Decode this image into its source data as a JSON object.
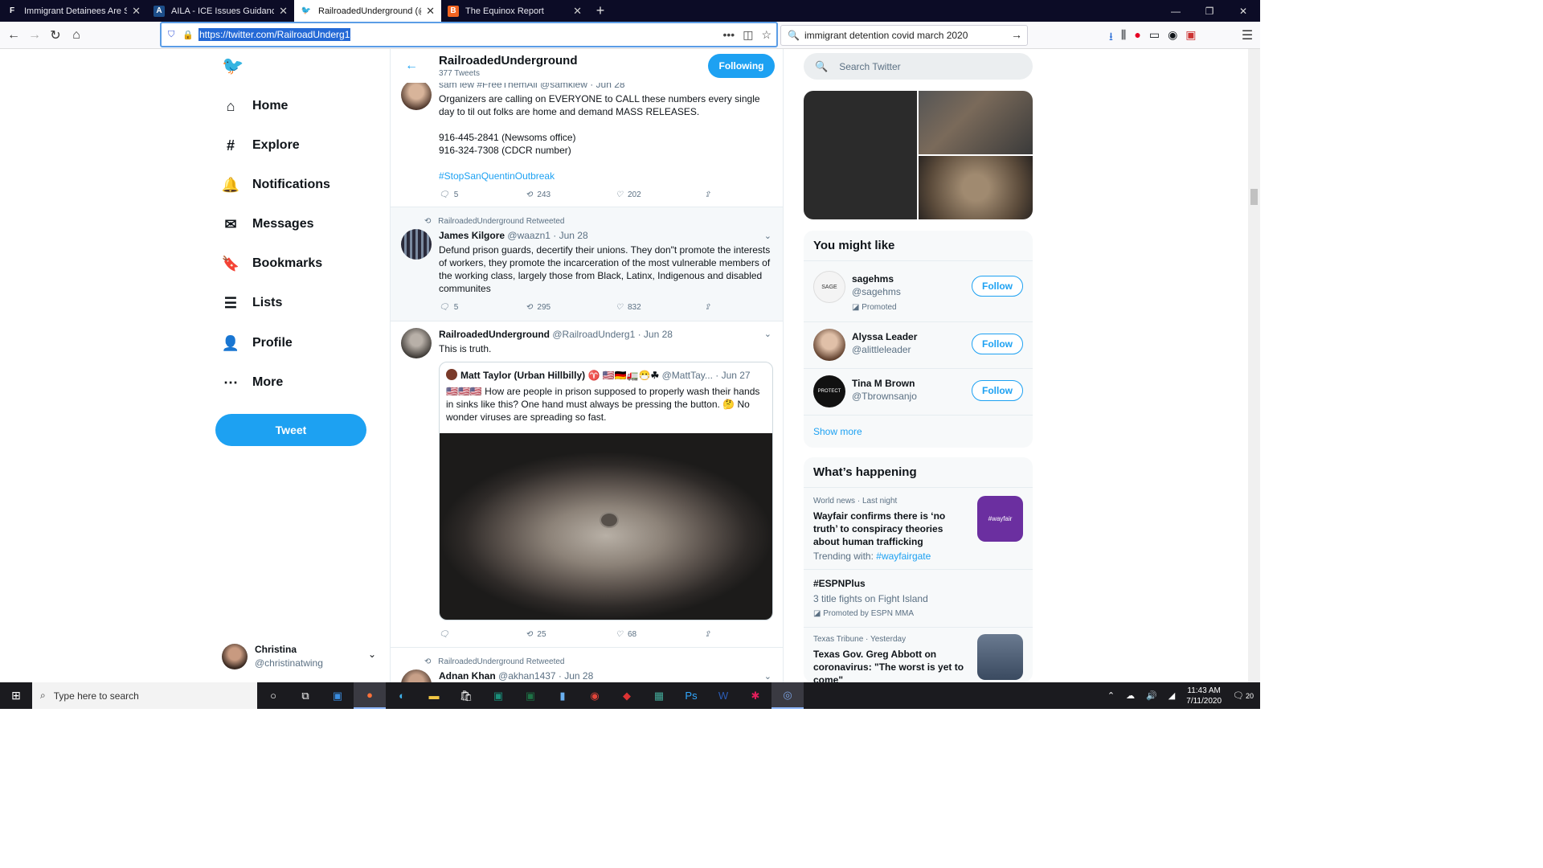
{
  "browser": {
    "tabs": [
      {
        "favicon": "F",
        "title": "Immigrant Detainees Are Sittin",
        "active": false
      },
      {
        "favicon": "A",
        "title": "AILA - ICE Issues Guidance on C",
        "active": false
      },
      {
        "favicon": "t",
        "title": "RailroadedUnderground (@Rai",
        "active": true
      },
      {
        "favicon": "B",
        "title": "The Equinox Report",
        "active": false
      }
    ],
    "url": "https://twitter.com/RailroadUnderg1",
    "search_query": "immigrant detention covid march 2020"
  },
  "sidebar": {
    "items": [
      {
        "label": "Home",
        "icon": "home-icon"
      },
      {
        "label": "Explore",
        "icon": "hashtag-icon"
      },
      {
        "label": "Notifications",
        "icon": "bell-icon"
      },
      {
        "label": "Messages",
        "icon": "envelope-icon"
      },
      {
        "label": "Bookmarks",
        "icon": "bookmark-icon"
      },
      {
        "label": "Lists",
        "icon": "list-icon"
      },
      {
        "label": "Profile",
        "icon": "person-icon"
      },
      {
        "label": "More",
        "icon": "more-icon"
      }
    ],
    "tweet_button": "Tweet",
    "account": {
      "name": "Christina",
      "handle": "@christinatwing"
    }
  },
  "profile_header": {
    "name": "RailroadedUnderground",
    "tweet_count": "377 Tweets",
    "follow_label": "Following"
  },
  "tweets": [
    {
      "header": "sam lew #FreeThemAll @samklew · Jun 28",
      "text1": "Organizers are calling on EVERYONE to CALL these numbers every single day to til out folks are home and demand MASS RELEASES.",
      "phone1": "916-445-2841 (Newsoms office)",
      "phone2": "916-324-7308 (CDCR number)",
      "hashtag": "#StopSanQuentinOutbreak",
      "replies": "5",
      "retweets": "243",
      "likes": "202"
    },
    {
      "retweeted_by": "RailroadedUnderground Retweeted",
      "name": "James Kilgore",
      "meta": "@waazn1 · Jun 28",
      "text": "Defund prison guards, decertify their unions. They don\"t promote the interests of workers, they promote the incarceration of the most vulnerable members of the working class, largely those from Black, Latinx, Indigenous and disabled communites",
      "replies": "5",
      "retweets": "295",
      "likes": "832"
    },
    {
      "name": "RailroadedUnderground",
      "meta": "@RailroadUnderg1 · Jun 28",
      "text": "This is truth.",
      "quote": {
        "name": "Matt Taylor (Urban Hillbilly) ♈ 🇺🇸🇩🇪🚛😷☘",
        "meta": "@MattTay... · Jun 27",
        "text": "🇺🇸🇺🇸🇺🇸 How are people in prison supposed to properly wash their hands in sinks like this? One hand must always be pressing the button. 🤔 No wonder viruses are spreading so fast."
      },
      "retweets": "25",
      "likes": "68"
    },
    {
      "retweeted_by": "RailroadedUnderground Retweeted",
      "name": "Adnan Khan",
      "meta": "@akhan1437 · Jun 28"
    }
  ],
  "right": {
    "search_placeholder": "Search Twitter",
    "you_might_like": {
      "title": "You might like",
      "people": [
        {
          "name": "sagehms",
          "handle": "@sagehms",
          "promoted": "Promoted",
          "button": "Follow"
        },
        {
          "name": "Alyssa Leader",
          "handle": "@alittleleader",
          "button": "Follow"
        },
        {
          "name": "Tina M Brown",
          "handle": "@Tbrownsanjo",
          "button": "Follow"
        }
      ],
      "show_more": "Show more"
    },
    "whats_happening": {
      "title": "What’s happening",
      "trends": [
        {
          "meta": "World news · Last night",
          "title": "Wayfair confirms there is ‘no truth’ to conspiracy theories about human trafficking",
          "extra_label": "Trending with: ",
          "extra_tag": "#wayfairgate"
        },
        {
          "title": "#ESPNPlus",
          "sub": "3 title fights on Fight Island",
          "promoted": "Promoted by ESPN MMA"
        },
        {
          "meta": "Texas Tribune · Yesterday",
          "title": "Texas Gov. Greg Abbott on coronavirus: \"The worst is yet to come\""
        }
      ]
    }
  },
  "taskbar": {
    "search_placeholder": "Type here to search",
    "time": "11:43 AM",
    "date": "7/11/2020",
    "notifications": "20"
  }
}
